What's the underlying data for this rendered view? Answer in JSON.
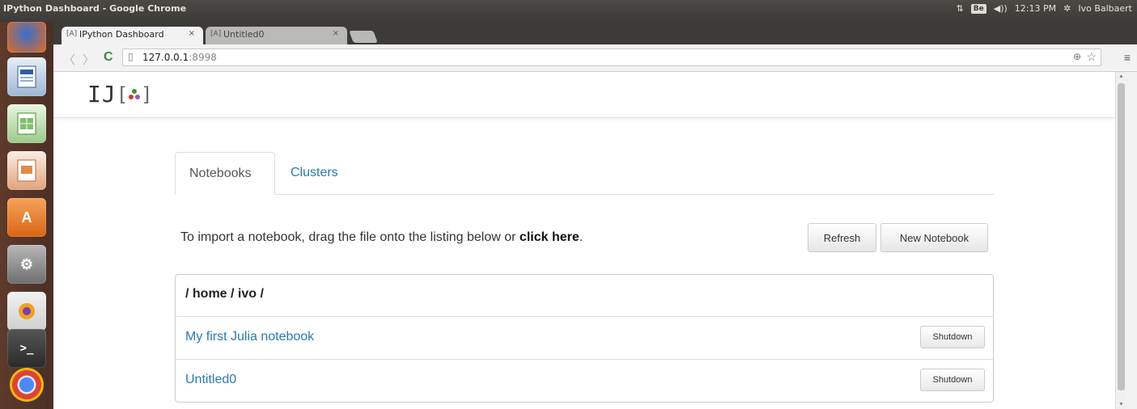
{
  "system": {
    "window_title": "IPython Dashboard - Google Chrome",
    "indicator_box": "Be",
    "clock": "12:13 PM",
    "user": "Ivo Balbaert"
  },
  "browser": {
    "tabs": [
      {
        "favicon": "[A]",
        "label": "IPython Dashboard",
        "close": "×"
      },
      {
        "favicon": "[A]",
        "label": "Untitled0",
        "close": "×"
      }
    ],
    "url_host": "127.0.0.1",
    "url_port": ":8998"
  },
  "launcher": {
    "items": [
      "firefox-icon",
      "writer-icon",
      "calc-icon",
      "impress-icon",
      "software-center-icon",
      "system-settings-icon",
      "app-icon",
      "terminal-icon",
      "chrome-icon"
    ]
  },
  "page": {
    "logo_text": "IJ",
    "tabs": {
      "notebooks": "Notebooks",
      "clusters": "Clusters"
    },
    "import_prefix": "To import a notebook, drag the file onto the listing below or ",
    "import_link": "click here",
    "import_suffix": ".",
    "buttons": {
      "refresh": "Refresh",
      "new_notebook": "New Notebook"
    },
    "listing": {
      "path": "/ home / ivo /",
      "notebooks": [
        {
          "name": "My first Julia notebook",
          "action": "Shutdown"
        },
        {
          "name": "Untitled0",
          "action": "Shutdown"
        }
      ]
    }
  }
}
